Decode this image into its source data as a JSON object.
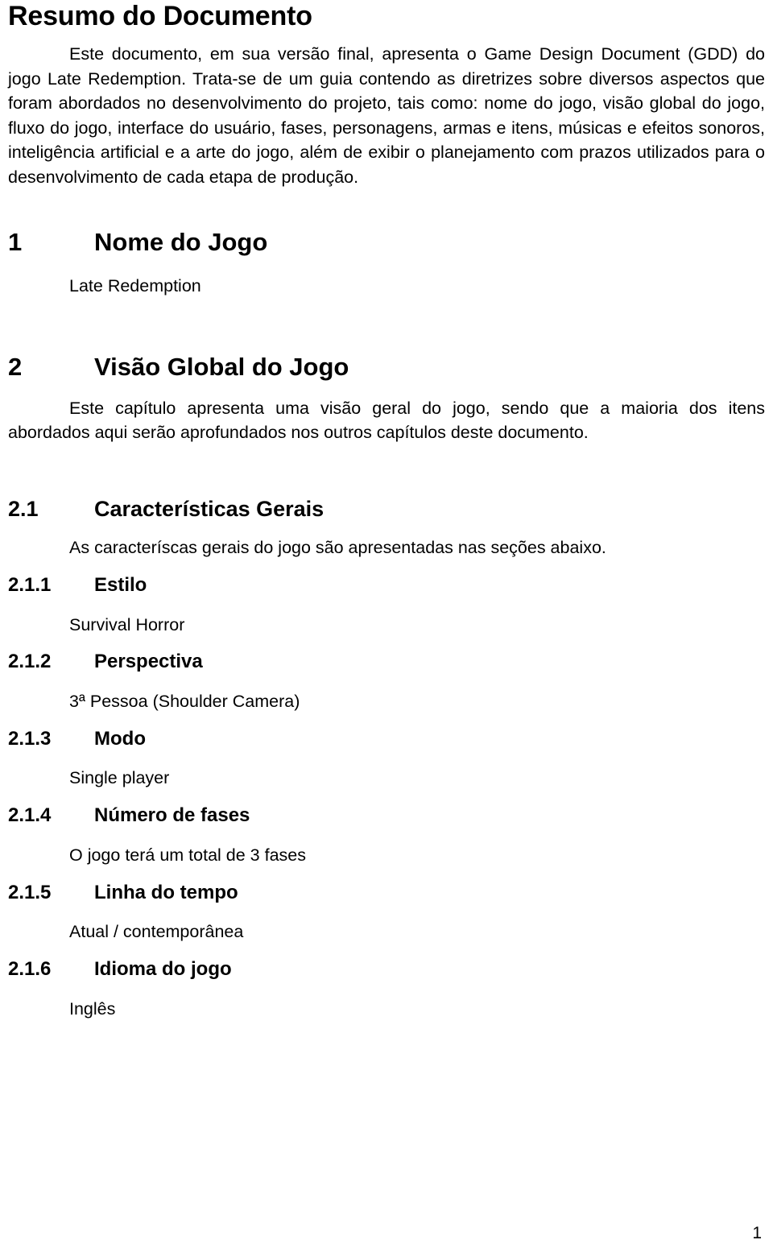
{
  "document": {
    "title": "Resumo do Documento",
    "page_number": "1",
    "summary_paragraph": "Este documento, em sua versão final, apresenta o Game Design Document (GDD) do jogo Late Redemption. Trata-se de um guia contendo as diretrizes sobre diversos aspectos que foram abordados no desenvolvimento do projeto, tais como: nome do jogo, visão global do jogo, fluxo do jogo, interface do usuário, fases, personagens, armas e itens, músicas e efeitos sonoros, inteligência artificial e a arte do jogo, além de exibir o planejamento com prazos utilizados para o desenvolvimento de cada etapa de produção."
  },
  "sections": {
    "s1": {
      "number": "1",
      "title": "Nome do Jogo",
      "body": "Late Redemption"
    },
    "s2": {
      "number": "2",
      "title": "Visão Global do Jogo",
      "body": "Este capítulo apresenta uma visão geral do jogo, sendo que a maioria dos itens abordados aqui serão aprofundados nos outros capítulos deste documento."
    },
    "s2_1": {
      "number": "2.1",
      "title": "Características Gerais",
      "body": "As caracteríscas gerais do jogo são apresentadas nas seções abaixo."
    },
    "s2_1_1": {
      "number": "2.1.1",
      "title": "Estilo",
      "body": "Survival Horror"
    },
    "s2_1_2": {
      "number": "2.1.2",
      "title": "Perspectiva",
      "body": "3ª Pessoa (Shoulder Camera)"
    },
    "s2_1_3": {
      "number": "2.1.3",
      "title": "Modo",
      "body": "Single player"
    },
    "s2_1_4": {
      "number": "2.1.4",
      "title": "Número de fases",
      "body": "O jogo terá um total de 3 fases"
    },
    "s2_1_5": {
      "number": "2.1.5",
      "title": "Linha do tempo",
      "body": "Atual / contemporânea"
    },
    "s2_1_6": {
      "number": "2.1.6",
      "title": "Idioma do jogo",
      "body": "Inglês"
    }
  }
}
